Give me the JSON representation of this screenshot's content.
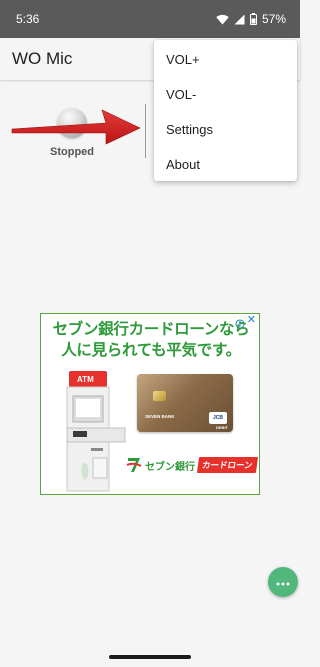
{
  "status_bar": {
    "time": "5:36",
    "battery": "57%",
    "icons": [
      "wifi-icon",
      "signal-icon",
      "battery-icon"
    ]
  },
  "app_bar": {
    "title": "WO Mic"
  },
  "main": {
    "status_label": "Stopped",
    "annotation": "red-arrow-pointing-to-menu"
  },
  "overflow_menu": {
    "items": [
      {
        "label": "VOL+"
      },
      {
        "label": "VOL-"
      },
      {
        "label": "Settings"
      },
      {
        "label": "About"
      }
    ]
  },
  "ad": {
    "headline_line1": "セブン銀行カードローンなら",
    "headline_line2": "人に見られても平気です。",
    "atm_label": "ATM",
    "card_bank": "SEVEN BANK",
    "card_brand": "JCB",
    "card_type": "DEBIT",
    "brand_name": "セブン銀行",
    "brand_tag": "カードローン",
    "close_label": "✕"
  },
  "colors": {
    "status_bar": "#5a5a5a",
    "background": "#f5f5f5",
    "ad_green": "#2f9a3a",
    "ad_red": "#e6312c",
    "fab": "#52b77a",
    "arrow": "#d42020"
  }
}
